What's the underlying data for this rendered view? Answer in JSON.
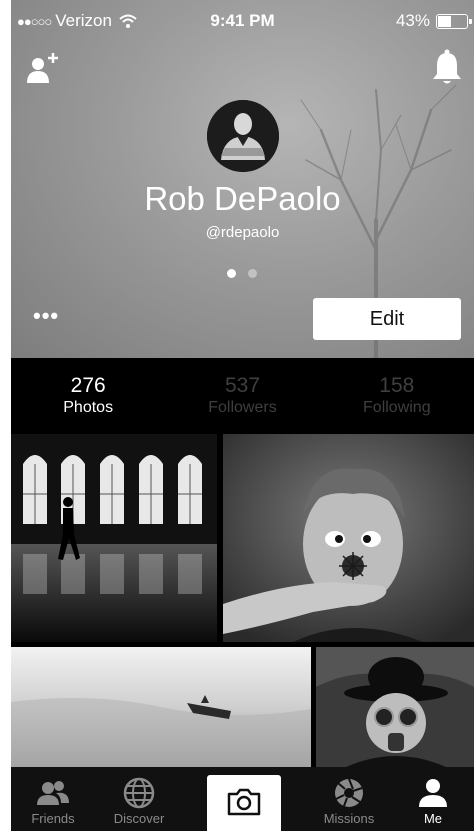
{
  "status_bar": {
    "signal": "●●○○○",
    "carrier": "Verizon",
    "time": "9:41 PM",
    "battery_text": "43%",
    "battery_level": 0.43
  },
  "profile": {
    "name": "Rob DePaolo",
    "handle": "@rdepaolo",
    "more_label": "•••",
    "edit_label": "Edit",
    "page_count": 2,
    "active_page": 1
  },
  "stats": [
    {
      "value": "276",
      "label": "Photos",
      "active": true
    },
    {
      "value": "537",
      "label": "Followers",
      "active": false
    },
    {
      "value": "158",
      "label": "Following",
      "active": false
    }
  ],
  "photos": [
    {
      "subject": "silhouette-walking-arched-windows"
    },
    {
      "subject": "boy-with-flower-on-nose"
    },
    {
      "subject": "rowboat-in-fog"
    },
    {
      "subject": "figure-with-bowler-hat-and-gas-mask"
    }
  ],
  "tabbar": {
    "items": [
      {
        "label": "Friends",
        "icon": "friends-icon",
        "active": false
      },
      {
        "label": "Discover",
        "icon": "globe-icon",
        "active": false
      },
      {
        "label": "",
        "icon": "camera-icon",
        "active": false
      },
      {
        "label": "Missions",
        "icon": "aperture-icon",
        "active": false
      },
      {
        "label": "Me",
        "icon": "person-icon",
        "active": true
      }
    ]
  },
  "colors": {
    "tabbar_bg": "#111111",
    "header_bg": "#9a9a9a",
    "inactive_stat": "#3f3f3f"
  }
}
